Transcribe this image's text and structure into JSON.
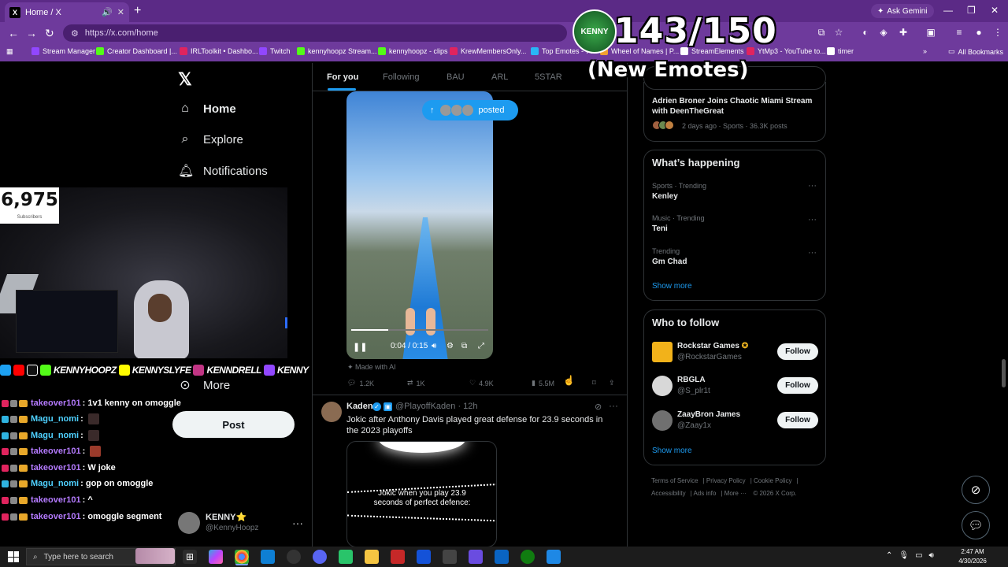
{
  "browser": {
    "tab_title": "Home / X",
    "url": "https://x.com/home",
    "ask_gemini": "Ask Gemini",
    "bookmarks": [
      {
        "label": "Stream Manager",
        "color": "#9147ff"
      },
      {
        "label": "Creator Dashboard |...",
        "color": "#53fc18"
      },
      {
        "label": "IRLToolkit • Dashbo...",
        "color": "#e0245e"
      },
      {
        "label": "Twitch",
        "color": "#9147ff"
      },
      {
        "label": "kennyhoopz Stream...",
        "color": "#53fc18"
      },
      {
        "label": "kennyhoopz - clips",
        "color": "#53fc18"
      },
      {
        "label": "KrewMembersOnly...",
        "color": "#e0245e"
      },
      {
        "label": "Top Emotes - 7TV",
        "color": "#29b6f6"
      },
      {
        "label": "Wheel of Names | P...",
        "color": "#f0a030"
      },
      {
        "label": "StreamElements",
        "color": "#ffffff"
      },
      {
        "label": "YtMp3 - YouTube to...",
        "color": "#e0245e"
      },
      {
        "label": "timer",
        "color": "#ffffff"
      }
    ],
    "all_bookmarks": "All Bookmarks"
  },
  "overlay": {
    "counter": "143/150",
    "subtitle": "(New Emotes)",
    "logo_text": "KENNY",
    "subscriber_count": "6,975",
    "subscriber_label": "Subscribers",
    "socials": [
      "KENNYHOOPZ",
      "KENNYSLYFE",
      "KENNDRELL",
      "KENNY"
    ]
  },
  "sidebar": {
    "home": "Home",
    "explore": "Explore",
    "notifications": "Notifications",
    "more": "More",
    "post_button": "Post",
    "account_name": "KENNY⭐",
    "account_handle": "@KennyHoopz"
  },
  "feed": {
    "tabs": [
      "For you",
      "Following",
      "BAU",
      "ARL",
      "5STAR"
    ],
    "active_tab": "For you",
    "posted_pill": "posted",
    "video": {
      "time": "0:04 / 0:15",
      "progress": 0.27
    },
    "made_with_ai": "Made with AI",
    "actions": {
      "replies": "1.2K",
      "reposts": "1K",
      "likes": "4.9K",
      "views": "5.5M"
    },
    "post2": {
      "name": "Kaden",
      "handle": "@PlayoffKaden · 12h",
      "text": "Jokic after Anthony Davis played great defense for 23.9 seconds in the 2023 playoffs",
      "media_caption": "Jokic when you play 23.9 seconds of perfect defence:"
    }
  },
  "right": {
    "top_news": {
      "title": "Adrien Broner Joins Chaotic Miami Stream with DeenTheGreat",
      "meta": "2 days ago · Sports · 36.3K posts"
    },
    "happening_title": "What’s happening",
    "trends": [
      {
        "meta": "Sports · Trending",
        "name": "Kenley"
      },
      {
        "meta": "Music · Trending",
        "name": "Teni"
      },
      {
        "meta": "Trending",
        "name": "Gm Chad"
      }
    ],
    "show_more": "Show more",
    "who_to_follow": "Who to follow",
    "follow_suggestions": [
      {
        "name": "Rockstar Games",
        "handle": "@RockstarGames",
        "button": "Follow"
      },
      {
        "name": "RBGLA",
        "handle": "@S_plr1t",
        "button": "Follow"
      },
      {
        "name": "ZaayBron James",
        "handle": "@Zaay1x",
        "button": "Follow"
      }
    ],
    "footer": [
      "Terms of Service",
      "Privacy Policy",
      "Cookie Policy",
      "Accessibility",
      "Ads info",
      "More ···",
      "© 2026 X Corp."
    ]
  },
  "chat": [
    {
      "user": "takeover101",
      "msg": ": 1v1 kenny on omoggle",
      "type": "takeover"
    },
    {
      "user": "Magu_nomi",
      "msg": ":",
      "type": "magu",
      "emote": "dark"
    },
    {
      "user": "Magu_nomi",
      "msg": ":",
      "type": "magu",
      "emote": "dark"
    },
    {
      "user": "takeover101",
      "msg": ":",
      "type": "takeover",
      "emote": "red"
    },
    {
      "user": "takeover101",
      "msg": ": W joke",
      "type": "takeover"
    },
    {
      "user": "Magu_nomi",
      "msg": ": gop on omoggle",
      "type": "magu"
    },
    {
      "user": "takeover101",
      "msg": ": ^",
      "type": "takeover"
    },
    {
      "user": "takeover101",
      "msg": ": omoggle segment",
      "type": "takeover"
    }
  ],
  "taskbar": {
    "search_placeholder": "Type here to search",
    "time": "2:47 AM",
    "date": "4/30/2026"
  }
}
